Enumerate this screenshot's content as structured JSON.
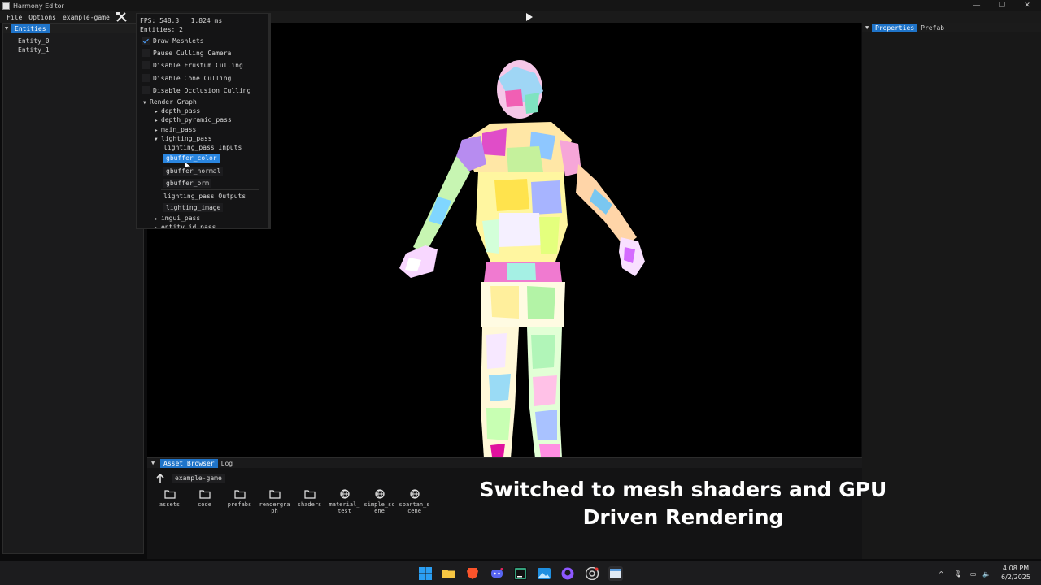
{
  "window": {
    "title": "Harmony Editor",
    "minimize": "—",
    "maximize": "❐",
    "close": "✕"
  },
  "menu": {
    "file": "File",
    "options": "Options",
    "project": "example-game"
  },
  "entities_panel": {
    "tab": "Entities",
    "items": [
      "Entity_0",
      "Entity_1"
    ]
  },
  "debug": {
    "fps": "FPS: 548.3 | 1.824 ms",
    "entities": "Entities: 2",
    "options": [
      {
        "label": "Draw Meshlets",
        "checked": true
      },
      {
        "label": "Pause Culling Camera",
        "checked": false
      },
      {
        "label": "Disable Frustum Culling",
        "checked": false
      },
      {
        "label": "Disable Cone Culling",
        "checked": false
      },
      {
        "label": "Disable Occlusion Culling",
        "checked": false
      }
    ],
    "render_graph": {
      "label": "Render Graph",
      "passes": {
        "depth_pass": "depth_pass",
        "depth_pyramid_pass": "depth_pyramid_pass",
        "main_pass": "main_pass",
        "lighting_pass": "lighting_pass",
        "imgui_pass": "imgui_pass",
        "entity_id_pass": "entity_id_pass"
      },
      "inputs_label": "lighting_pass Inputs",
      "inputs": [
        "gbuffer_color",
        "gbuffer_normal",
        "gbuffer_orm"
      ],
      "outputs_label": "lighting_pass Outputs",
      "outputs": [
        "lighting_image"
      ]
    }
  },
  "properties_panel": {
    "tab_properties": "Properties",
    "tab_prefab": "Prefab"
  },
  "bottom_panel": {
    "tab_assets": "Asset Browser",
    "tab_log": "Log",
    "path": "example-game",
    "items": [
      {
        "name": "assets",
        "icon": "folder-icon"
      },
      {
        "name": "code",
        "icon": "folder-icon"
      },
      {
        "name": "prefabs",
        "icon": "folder-icon"
      },
      {
        "name": "rendergraph",
        "icon": "folder-icon"
      },
      {
        "name": "shaders",
        "icon": "folder-icon"
      },
      {
        "name": "material_test",
        "icon": "globe-icon"
      },
      {
        "name": "simple_scene",
        "icon": "globe-icon"
      },
      {
        "name": "spartan_scene",
        "icon": "globe-icon"
      }
    ]
  },
  "caption": {
    "line1": "Switched to mesh shaders and GPU",
    "line2": "Driven Rendering"
  },
  "taskbar": {
    "time": "4:08 PM",
    "date": "6/2/2025"
  }
}
